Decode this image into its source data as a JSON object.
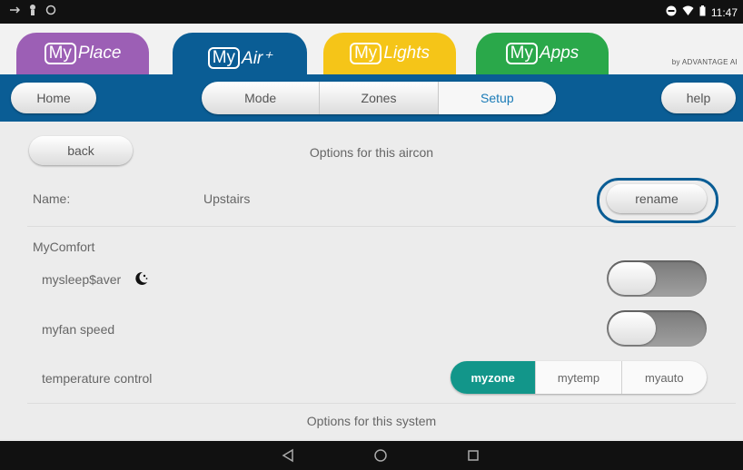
{
  "statusbar": {
    "time": "11:47"
  },
  "apps": {
    "tabs": [
      {
        "prefix": "My",
        "suffix": "Place",
        "color": "#9c5fb5"
      },
      {
        "prefix": "My",
        "suffix": "Air⁺",
        "color": "#0a5d95"
      },
      {
        "prefix": "My",
        "suffix": "Lights",
        "color": "#f5c518"
      },
      {
        "prefix": "My",
        "suffix": "Apps",
        "color": "#2aa84a"
      }
    ],
    "brand": "by ADVANTAGE AI"
  },
  "nav": {
    "home": "Home",
    "help": "help",
    "segments": [
      "Mode",
      "Zones",
      "Setup"
    ],
    "active_segment": "Setup"
  },
  "page": {
    "back": "back",
    "title": "Options for this aircon",
    "name_label": "Name:",
    "name_value": "Upstairs",
    "rename": "rename",
    "section_mycomfort": "MyComfort",
    "mysleep_label": "mysleep$aver",
    "myfan_label": "myfan speed",
    "temp_label": "temperature control",
    "temp_options": [
      "myzone",
      "mytemp",
      "myauto"
    ],
    "temp_selected": "myzone",
    "system_title": "Options for this system"
  },
  "colors": {
    "nav_blue": "#0a5d95",
    "accent_teal": "#12968a"
  },
  "icons": {
    "moon": "moon-stars-icon",
    "back_nav": "nav-back-icon",
    "home_nav": "nav-home-icon",
    "recent_nav": "nav-recents-icon"
  }
}
